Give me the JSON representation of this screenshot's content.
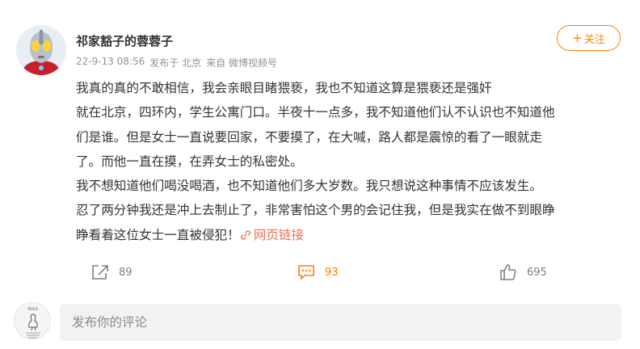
{
  "post": {
    "username": "祁家豁子的蓉蓉子",
    "meta": {
      "time": "22-9-13 08:56",
      "location": "发布于 北京",
      "source": "来自 微博视频号"
    },
    "follow_label": "关注",
    "follow_prefix": "+",
    "content_lines": [
      "我真的真的不敢相信，我会亲眼目睹猥亵，我也不知道这算是猥亵还是强奸",
      "就在北京，四环内，学生公寓门口。半夜十一点多，我不知道他们认不认识也不知道他",
      "们是谁。但是女士一直说要回家，不要摸了，在大喊，路人都是震惊的看了一眼就走",
      "了。而他一直在摸，在弄女士的私密处。",
      "我不想知道他们喝没喝酒，也不知道他们多大岁数。我只想说这种事情不应该发生。",
      "忍了两分钟我还是冲上去制止了，非常害怕这个男的会记住我，但是我实在做不到眼睁",
      "睁看着这位女士一直被侵犯！"
    ],
    "link_label": "网页链接",
    "actions": {
      "forward_count": "89",
      "comment_count": "93",
      "like_count": "695"
    },
    "comment_box": {
      "placeholder": "发布你的评论"
    }
  },
  "colors": {
    "accent": "#ff8200",
    "link": "#eb7350",
    "meta": "#939393"
  },
  "icons": {
    "forward": "share-forward-icon",
    "comment": "comment-bubble-icon",
    "like": "thumbs-up-icon",
    "link": "link-chain-icon"
  }
}
